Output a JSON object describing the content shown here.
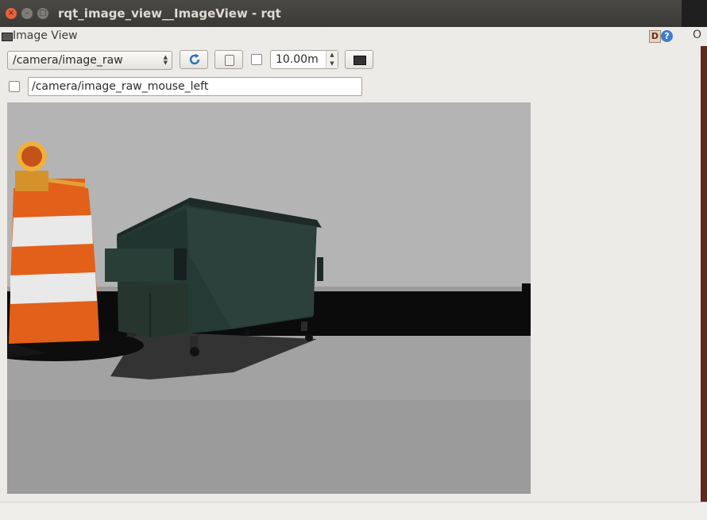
{
  "window": {
    "title": "rqt_image_view__ImageView - rqt"
  },
  "panel": {
    "title": "Image View",
    "debug_badge": "D",
    "help_icon": "?",
    "close_label": "O"
  },
  "toolbar": {
    "topic_selected": "/camera/image_raw",
    "zoom_checked": false,
    "smooth_value": "10.00m",
    "mouse_topic_checked": false,
    "mouse_topic_value": "/camera/image_raw_mouse_left"
  },
  "icons": {
    "close": "close-icon",
    "minimize": "minimize-icon",
    "maximize": "maximize-icon",
    "refresh": "refresh-icon",
    "save": "save-icon",
    "fit": "fit-window-icon"
  },
  "colors": {
    "titlebar": "#3c3b37",
    "close_button": "#e8623b",
    "window_bg": "#edebe7",
    "floor": "#9b9b9b",
    "sky": "#b4b4b4"
  }
}
